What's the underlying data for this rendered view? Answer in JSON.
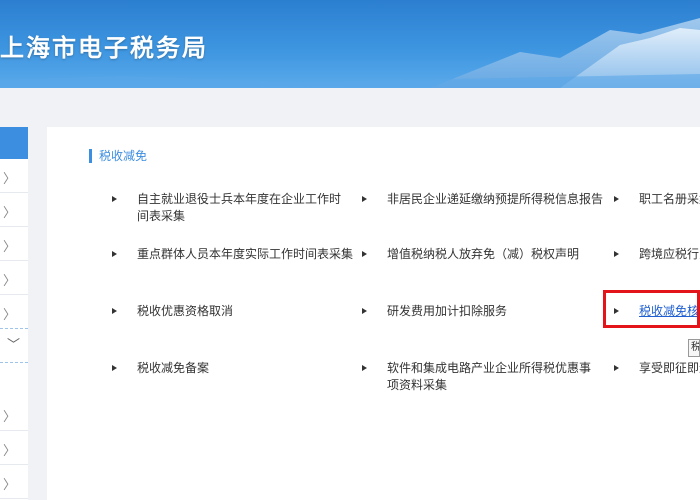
{
  "header": {
    "title": "上海市电子税务局"
  },
  "sidebar": {
    "chevron_glyph": "〉",
    "chevron_down_glyph": "﹀"
  },
  "section": {
    "title": "税收减免"
  },
  "services": [
    {
      "label": "自主就业退役士兵本年度在企业工作时间表采集"
    },
    {
      "label": "非居民企业递延缴纳预提所得税信息报告"
    },
    {
      "label": "职工名册采集"
    },
    {
      "label": "重点群体人员本年度实际工作时间表采集"
    },
    {
      "label": "增值税纳税人放弃免（减）税权声明"
    },
    {
      "label": "跨境应税行为"
    },
    {
      "label": "税收优惠资格取消"
    },
    {
      "label": "研发费用加计扣除服务"
    },
    {
      "label": "税收减免核准"
    },
    {
      "label": "税收减免备案"
    },
    {
      "label": "软件和集成电路产业企业所得税优惠事项资料采集"
    },
    {
      "label": "享受即征即退"
    }
  ],
  "tooltip": {
    "text": "税"
  }
}
